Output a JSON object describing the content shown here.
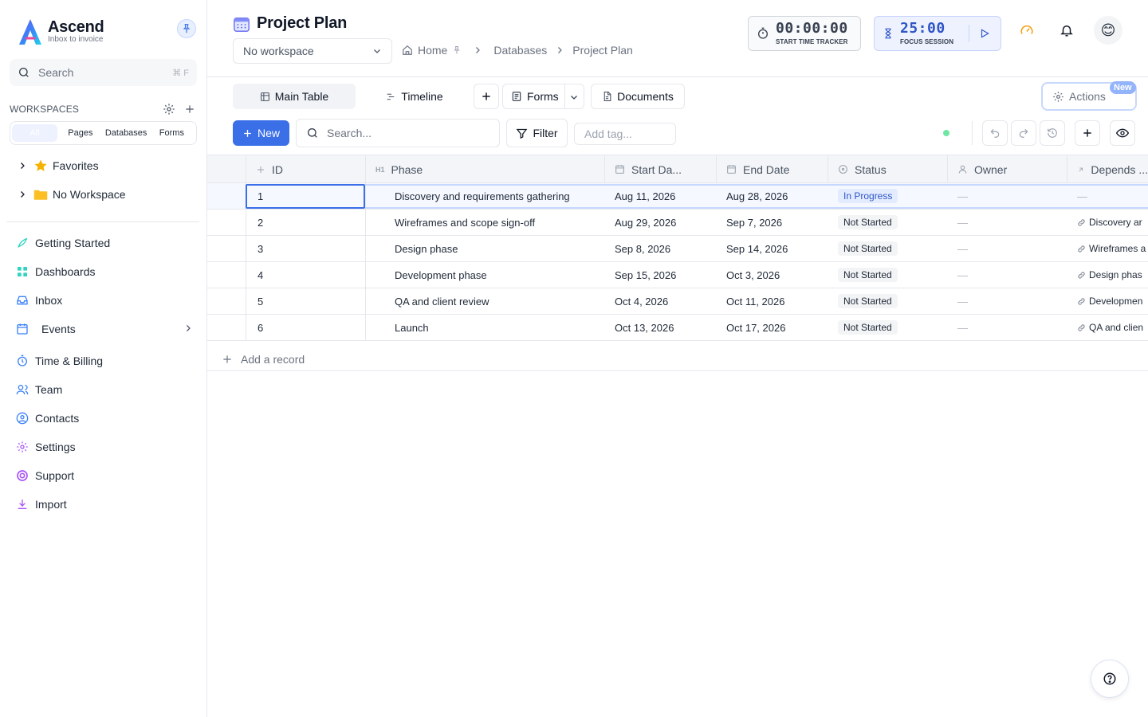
{
  "brand": {
    "name": "Ascend",
    "tagline": "Inbox to invoice"
  },
  "sidebar": {
    "search_label": "Search",
    "search_shortcut": "⌘ F",
    "workspaces_heading": "WORKSPACES",
    "ws_tabs": [
      "All",
      "Pages",
      "Databases",
      "Forms"
    ],
    "tree": [
      {
        "label": "Favorites",
        "icon": "star-icon"
      },
      {
        "label": "No Workspace",
        "icon": "folder-icon"
      }
    ],
    "nav": [
      {
        "label": "Getting Started",
        "icon": "rocket-icon"
      },
      {
        "label": "Dashboards",
        "icon": "dashboard-icon"
      },
      {
        "label": "Inbox",
        "icon": "inbox-icon"
      },
      {
        "label": "Events",
        "icon": "calendar-clock-icon"
      },
      {
        "label": "Time & Billing",
        "icon": "stopwatch-icon"
      },
      {
        "label": "Team",
        "icon": "users-icon"
      },
      {
        "label": "Contacts",
        "icon": "contact-icon"
      },
      {
        "label": "Settings",
        "icon": "gear-icon"
      },
      {
        "label": "Support",
        "icon": "lifebuoy-icon"
      },
      {
        "label": "Import",
        "icon": "download-icon"
      }
    ]
  },
  "header": {
    "title": "Project Plan",
    "workspace_select": "No workspace",
    "breadcrumb": [
      "Home",
      "Databases",
      "Project Plan"
    ],
    "time_tracker": {
      "value": "00:00:00",
      "label": "START TIME TRACKER"
    },
    "focus": {
      "value": "25:00",
      "label": "FOCUS SESSION"
    },
    "avatar": "😊"
  },
  "views": {
    "main_table": "Main Table",
    "timeline": "Timeline",
    "forms": "Forms",
    "documents": "Documents",
    "actions": "Actions",
    "new_badge": "New"
  },
  "toolbar": {
    "new_label": "New",
    "search_placeholder": "Search...",
    "filter_label": "Filter",
    "tag_placeholder": "Add tag..."
  },
  "table": {
    "columns": [
      "ID",
      "Phase",
      "Start Da...",
      "End Date",
      "Status",
      "Owner",
      "Depends ..."
    ],
    "rows": [
      {
        "id": "1",
        "phase": "Discovery and requirements gathering",
        "start": "Aug 11, 2026",
        "end": "Aug 28, 2026",
        "status": "In Progress",
        "owner": "—",
        "depends": "—"
      },
      {
        "id": "2",
        "phase": "Wireframes and scope sign-off",
        "start": "Aug 29, 2026",
        "end": "Sep 7, 2026",
        "status": "Not Started",
        "owner": "—",
        "depends": "Discovery ar"
      },
      {
        "id": "3",
        "phase": "Design phase",
        "start": "Sep 8, 2026",
        "end": "Sep 14, 2026",
        "status": "Not Started",
        "owner": "—",
        "depends": "Wireframes a"
      },
      {
        "id": "4",
        "phase": "Development phase",
        "start": "Sep 15, 2026",
        "end": "Oct 3, 2026",
        "status": "Not Started",
        "owner": "—",
        "depends": "Design phas"
      },
      {
        "id": "5",
        "phase": "QA and client review",
        "start": "Oct 4, 2026",
        "end": "Oct 11, 2026",
        "status": "Not Started",
        "owner": "—",
        "depends": "Developmen"
      },
      {
        "id": "6",
        "phase": "Launch",
        "start": "Oct 13, 2026",
        "end": "Oct 17, 2026",
        "status": "Not Started",
        "owner": "—",
        "depends": "QA and clien"
      }
    ],
    "add_record": "Add a record"
  },
  "colors": {
    "accent": "#3b6fe8",
    "in_progress_bg": "#e3ecff",
    "status_dot": "#6ee7a5"
  }
}
